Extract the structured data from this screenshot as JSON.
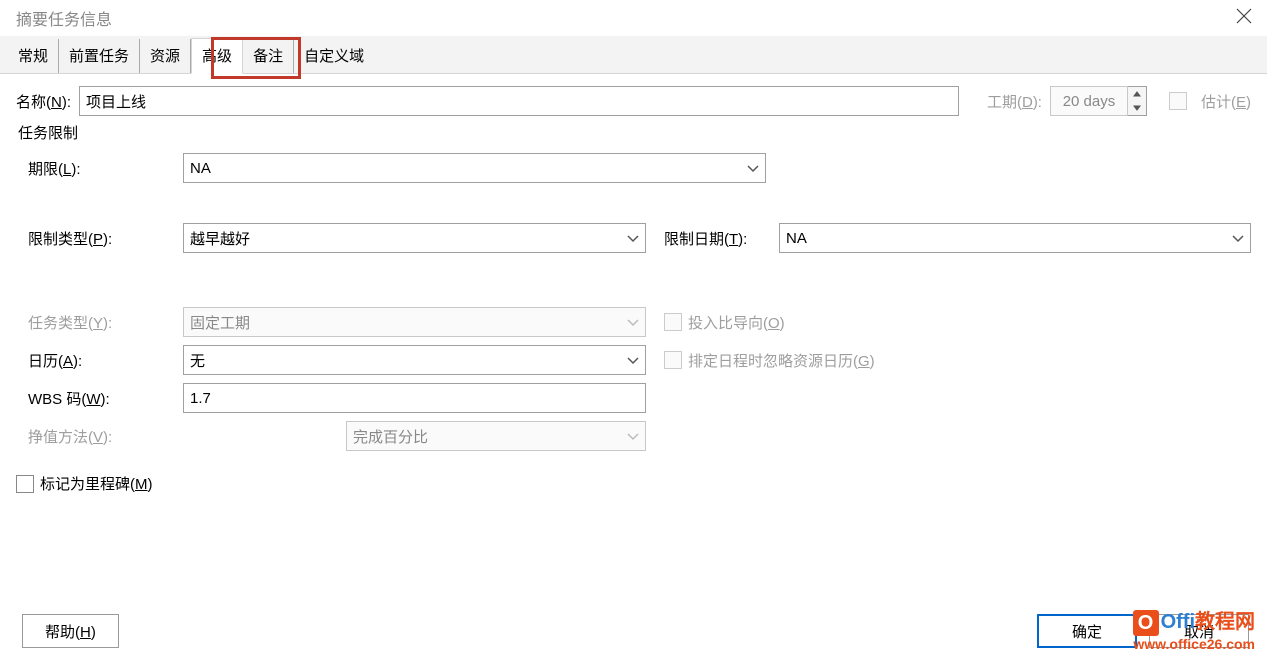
{
  "title": "摘要任务信息",
  "tabs": [
    "常规",
    "前置任务",
    "资源",
    "高级",
    "备注",
    "自定义域"
  ],
  "active_tab": "高级",
  "name": {
    "label_prefix": "名称(",
    "label_key": "N",
    "label_suffix": "):",
    "value": "项目上线"
  },
  "duration": {
    "label_prefix": "工期(",
    "label_key": "D",
    "label_suffix": "):",
    "value": "20 days"
  },
  "estimate": {
    "label_prefix": "估计(",
    "label_key": "E",
    "label_suffix": ")"
  },
  "section_constraint": "任务限制",
  "deadline": {
    "label_prefix": "期限(",
    "label_key": "L",
    "label_suffix": "):",
    "value": "NA"
  },
  "constraint_type": {
    "label_prefix": "限制类型(",
    "label_key": "P",
    "label_suffix": "):",
    "value": "越早越好"
  },
  "constraint_date": {
    "label_prefix": "限制日期(",
    "label_key": "T",
    "label_suffix": "):",
    "value": "NA"
  },
  "task_type": {
    "label_prefix": "任务类型(",
    "label_key": "Y",
    "label_suffix": "):",
    "value": "固定工期"
  },
  "effort_driven": {
    "label_prefix": "投入比导向(",
    "label_key": "O",
    "label_suffix": ")"
  },
  "calendar": {
    "label_prefix": "日历(",
    "label_key": "A",
    "label_suffix": "):",
    "value": "无"
  },
  "ignore_res_cal": {
    "label_prefix": "排定日程时忽略资源日历(",
    "label_key": "G",
    "label_suffix": ")"
  },
  "wbs": {
    "label_prefix": "WBS 码(",
    "label_key": "W",
    "label_suffix": "):",
    "value": "1.7"
  },
  "earned_value": {
    "label_prefix": "挣值方法(",
    "label_key": "V",
    "label_suffix": "):",
    "value": "完成百分比"
  },
  "milestone": {
    "label_prefix": "标记为里程碑(",
    "label_key": "M",
    "label_suffix": ")"
  },
  "buttons": {
    "help_prefix": "帮助(",
    "help_key": "H",
    "help_suffix": ")",
    "ok": "确定",
    "cancel": "取消"
  },
  "watermark": {
    "line1a": "Offi",
    "line1b": "教程",
    "line1c": "网",
    "line2": "www.office26.com",
    "icon": "O"
  }
}
